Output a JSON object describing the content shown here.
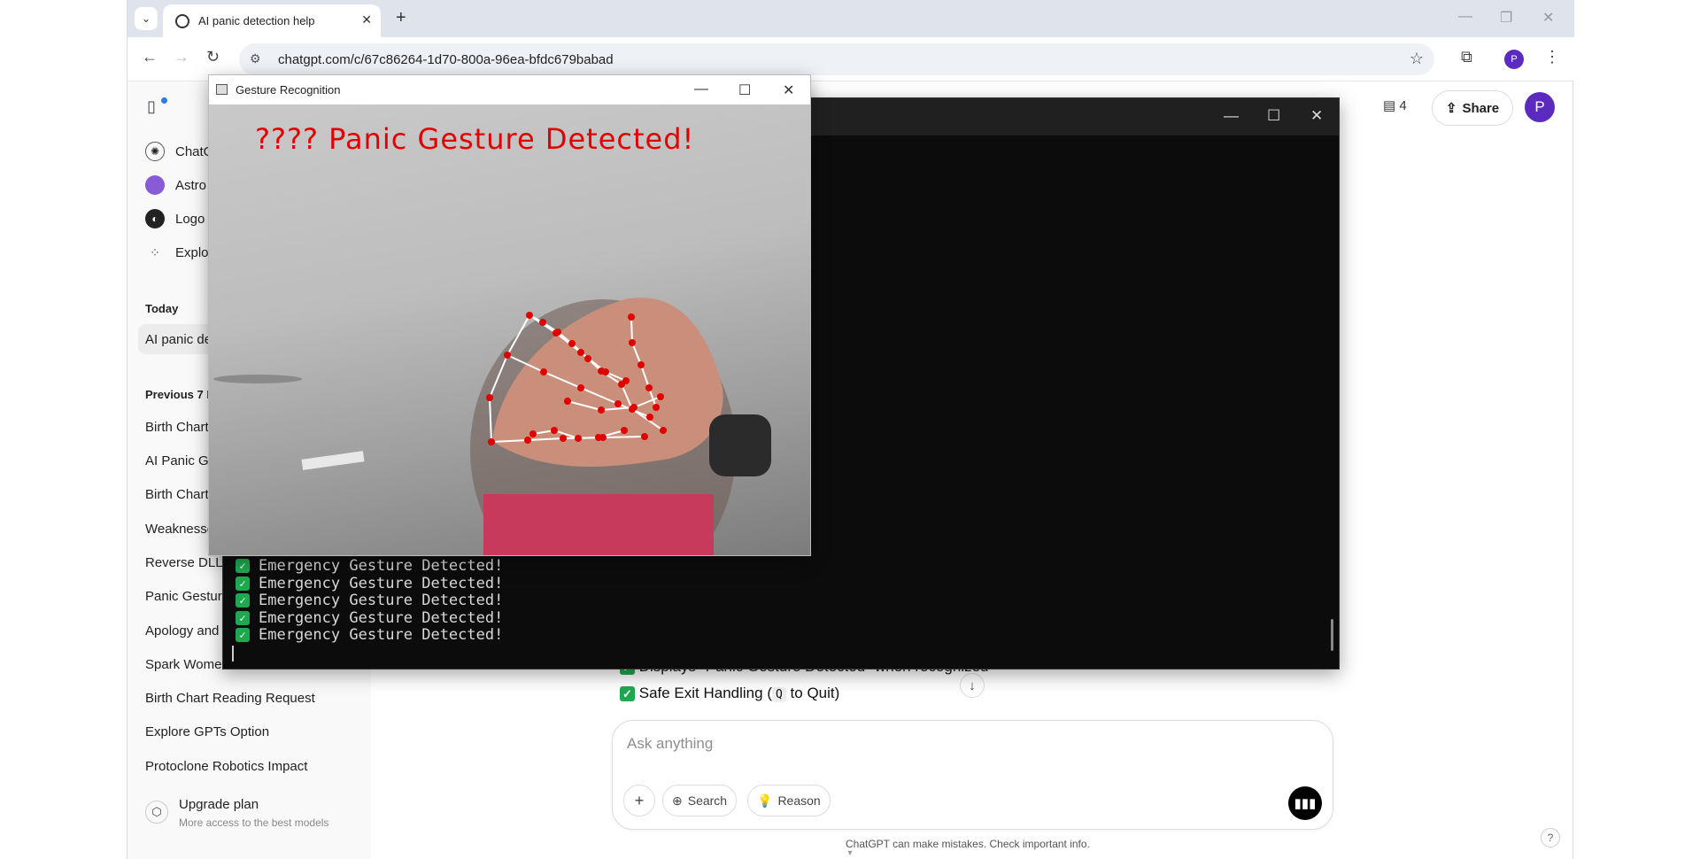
{
  "browser": {
    "tab_title": "AI panic detection help",
    "url": "chatgpt.com/c/67c86264-1d70-800a-96ea-bfdc679babad",
    "profile_initial": "P"
  },
  "sidebar": {
    "top_items": [
      {
        "label": "ChatG",
        "icon": "chatgpt-icon"
      },
      {
        "label": "Astro",
        "icon": "astro-gpt-icon"
      },
      {
        "label": "Logo",
        "icon": "logo-gpt-icon"
      },
      {
        "label": "Explo",
        "icon": "explore-grid-icon"
      }
    ],
    "today_heading": "Today",
    "today_chats": [
      "AI panic de"
    ],
    "prev_heading": "Previous 7 D",
    "prev_chats": [
      "Birth Chart",
      "AI Panic Ge",
      "Birth Chart",
      "Weaknesse",
      "Reverse DLL a",
      "Panic Gesture",
      "Apology and",
      "Spark Women",
      "Birth Chart Reading Request",
      "Explore GPTs Option",
      "Protoclone Robotics Impact"
    ],
    "upgrade_title": "Upgrade plan",
    "upgrade_subtitle": "More access to the best models"
  },
  "header": {
    "notes_count": "4",
    "share_label": "Share",
    "avatar_initial": "P"
  },
  "chat": {
    "partial_line": "Displays \"Panic Gesture Detected\" when recognized",
    "safe_exit_line": "Safe Exit Handling (",
    "safe_exit_key": "Q",
    "safe_exit_suffix": "to Quit)"
  },
  "composer": {
    "placeholder": "Ask anything",
    "search_label": "Search",
    "reason_label": "Reason"
  },
  "disclaimer": "ChatGPT can make mistakes. Check important info.",
  "terminal": {
    "lines": [
      "Emergency Gesture Detected!",
      "Emergency Gesture Detected!",
      "Emergency Gesture Detected!",
      "Emergency Gesture Detected!",
      "Emergency Gesture Detected!"
    ]
  },
  "gesture_window": {
    "title": "Gesture Recognition",
    "overlay_text": "???? Panic Gesture Detected!"
  },
  "colors": {
    "accent_purple": "#5b2bbf",
    "check_green": "#1fa84f",
    "overlay_red": "#e00000"
  }
}
